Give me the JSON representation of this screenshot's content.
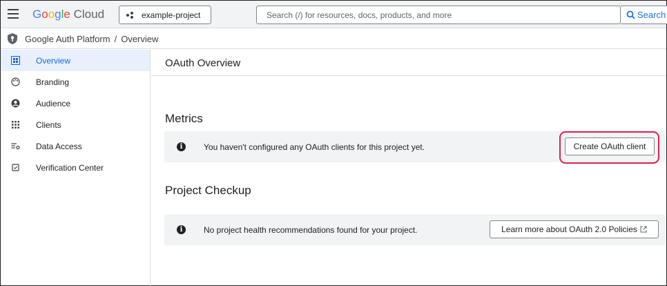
{
  "topbar": {
    "logo_google": "Google",
    "logo_cloud": "Cloud",
    "project_name": "example-project",
    "search_placeholder": "Search (/) for resources, docs, products, and more",
    "search_button": "Search"
  },
  "breadcrumb": {
    "items": [
      "Google Auth Platform",
      "Overview"
    ],
    "separator": "/"
  },
  "sidebar": {
    "items": [
      {
        "label": "Overview",
        "icon": "dashboard-icon",
        "active": true
      },
      {
        "label": "Branding",
        "icon": "palette-icon",
        "active": false
      },
      {
        "label": "Audience",
        "icon": "account-circle-icon",
        "active": false
      },
      {
        "label": "Clients",
        "icon": "grid-icon",
        "active": false
      },
      {
        "label": "Data Access",
        "icon": "tune-icon",
        "active": false
      },
      {
        "label": "Verification Center",
        "icon": "checkbox-icon",
        "active": false
      }
    ]
  },
  "main": {
    "title": "OAuth Overview",
    "metrics": {
      "title": "Metrics",
      "message": "You haven't configured any OAuth clients for this project yet.",
      "button": "Create OAuth client"
    },
    "checkup": {
      "title": "Project Checkup",
      "message": "No project health recommendations found for your project.",
      "button": "Learn more about OAuth 2.0 Policies"
    }
  },
  "colors": {
    "accent": "#1a73e8",
    "active_bg": "#e8f0fe",
    "highlight": "#d8224a"
  }
}
